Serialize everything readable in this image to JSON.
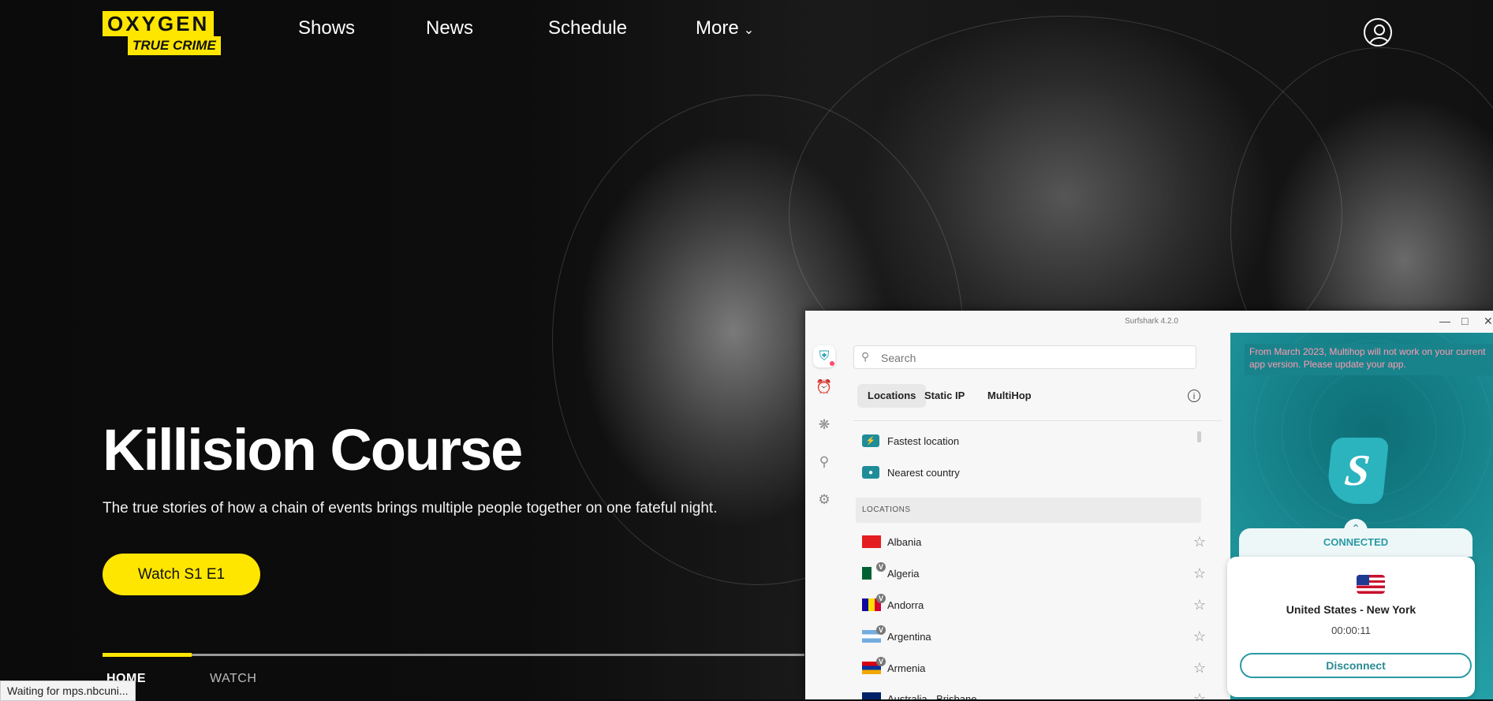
{
  "site": {
    "logo_top": "OXYGEN",
    "logo_bottom": "TRUE CRIME",
    "nav": [
      "Shows",
      "News",
      "Schedule",
      "More"
    ],
    "hero": {
      "title": "Killision Course",
      "description": "The true stories of how a chain of events brings multiple people together on one fateful night.",
      "cta": "Watch S1 E1"
    },
    "tabs": [
      "HOME",
      "WATCH"
    ],
    "status_text": "Waiting for mps.nbcuni...",
    "accent_color": "#ffe600"
  },
  "vpn": {
    "window_title": "Surfshark 4.2.0",
    "search_placeholder": "Search",
    "segments": [
      "Locations",
      "Static IP",
      "MultiHop"
    ],
    "quick": [
      "Fastest location",
      "Nearest country"
    ],
    "section_header": "LOCATIONS",
    "countries": [
      "Albania",
      "Algeria",
      "Andorra",
      "Argentina",
      "Armenia",
      "Australia - Brisbane"
    ],
    "warning": "From March 2023, Multihop will not work on your current app version. Please update your app.",
    "status": "CONNECTED",
    "location": "United States - New York",
    "timer": "00:00:11",
    "disconnect": "Disconnect",
    "accent_color": "#2a9aa4"
  }
}
